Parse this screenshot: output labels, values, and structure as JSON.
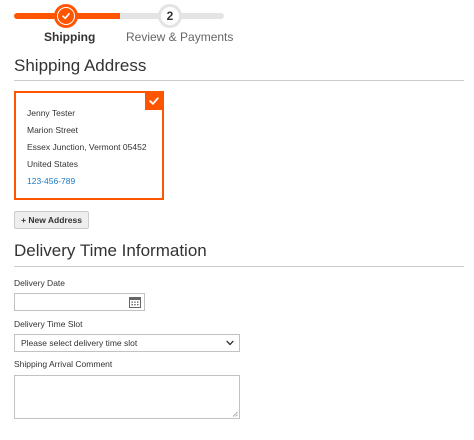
{
  "progress": {
    "steps": [
      {
        "label": "Shipping",
        "state": "complete"
      },
      {
        "number": "2",
        "label": "Review & Payments",
        "state": "pending"
      }
    ]
  },
  "shipping": {
    "title": "Shipping Address",
    "address": {
      "name": "Jenny Tester",
      "street": "Marion Street",
      "city_line": "Essex Junction, Vermont 05452",
      "country": "United States",
      "phone": "123-456-789",
      "selected": true
    },
    "new_address_label": "+ New Address"
  },
  "delivery": {
    "title": "Delivery Time Information",
    "date_label": "Delivery Date",
    "date_value": "",
    "slot_label": "Delivery Time Slot",
    "slot_selected": "Please select delivery time slot",
    "comment_label": "Shipping Arrival Comment",
    "comment_value": ""
  },
  "colors": {
    "accent": "#ff5501",
    "link": "#1979c3",
    "inactive": "#e4e4e4"
  },
  "icons": [
    "checkmark-icon",
    "calendar-icon",
    "chevron-down-icon",
    "resize-handle-icon"
  ]
}
